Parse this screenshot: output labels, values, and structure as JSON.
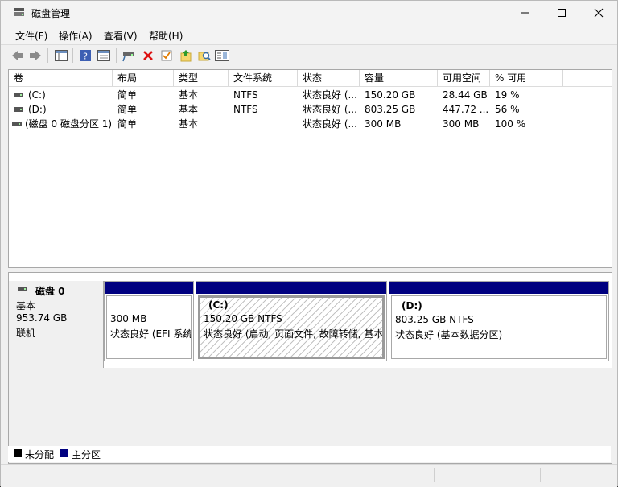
{
  "window": {
    "title": "磁盘管理",
    "controls": [
      "minimize-icon",
      "maximize-icon",
      "close-icon"
    ]
  },
  "menu": [
    {
      "label": "文件(F)"
    },
    {
      "label": "操作(A)"
    },
    {
      "label": "查看(V)"
    },
    {
      "label": "帮助(H)"
    }
  ],
  "toolbar": {
    "icons": [
      "back-icon",
      "forward-icon",
      "console-tree-icon",
      "help-icon",
      "properties-icon",
      "connect-disk-icon",
      "delete-icon",
      "check-icon",
      "up-folder-icon",
      "search-folder-icon",
      "settings-list-icon"
    ]
  },
  "volume_table": {
    "columns": [
      "卷",
      "布局",
      "类型",
      "文件系统",
      "状态",
      "容量",
      "可用空间",
      "% 可用"
    ],
    "rows": [
      {
        "volume": "(C:)",
        "layout": "简单",
        "type": "基本",
        "fs": "NTFS",
        "status": "状态良好 (...",
        "capacity": "150.20 GB",
        "free": "28.44 GB",
        "pct": "19 %"
      },
      {
        "volume": "(D:)",
        "layout": "简单",
        "type": "基本",
        "fs": "NTFS",
        "status": "状态良好 (...",
        "capacity": "803.25 GB",
        "free": "447.72 ...",
        "pct": "56 %"
      },
      {
        "volume": "(磁盘 0 磁盘分区 1)",
        "layout": "简单",
        "type": "基本",
        "fs": "",
        "status": "状态良好 (...",
        "capacity": "300 MB",
        "free": "300 MB",
        "pct": "100 %"
      }
    ]
  },
  "disk0": {
    "name": "磁盘 0",
    "kind": "基本",
    "size": "953.74 GB",
    "state": "联机",
    "partitions": [
      {
        "label": "",
        "size_line": "300 MB",
        "status_line": "状态良好 (EFI 系统分区)"
      },
      {
        "label": "(C:)",
        "size_line": "150.20 GB NTFS",
        "status_line": "状态良好 (启动, 页面文件, 故障转储, 基本数据分区)"
      },
      {
        "label": "(D:)",
        "size_line": "803.25 GB NTFS",
        "status_line": "状态良好 (基本数据分区)"
      }
    ]
  },
  "legend": [
    {
      "label": "未分配",
      "color": "#000000"
    },
    {
      "label": "主分区",
      "color": "#000080"
    }
  ],
  "colors": {
    "primary_partition": "#000080",
    "unallocated": "#000000"
  }
}
